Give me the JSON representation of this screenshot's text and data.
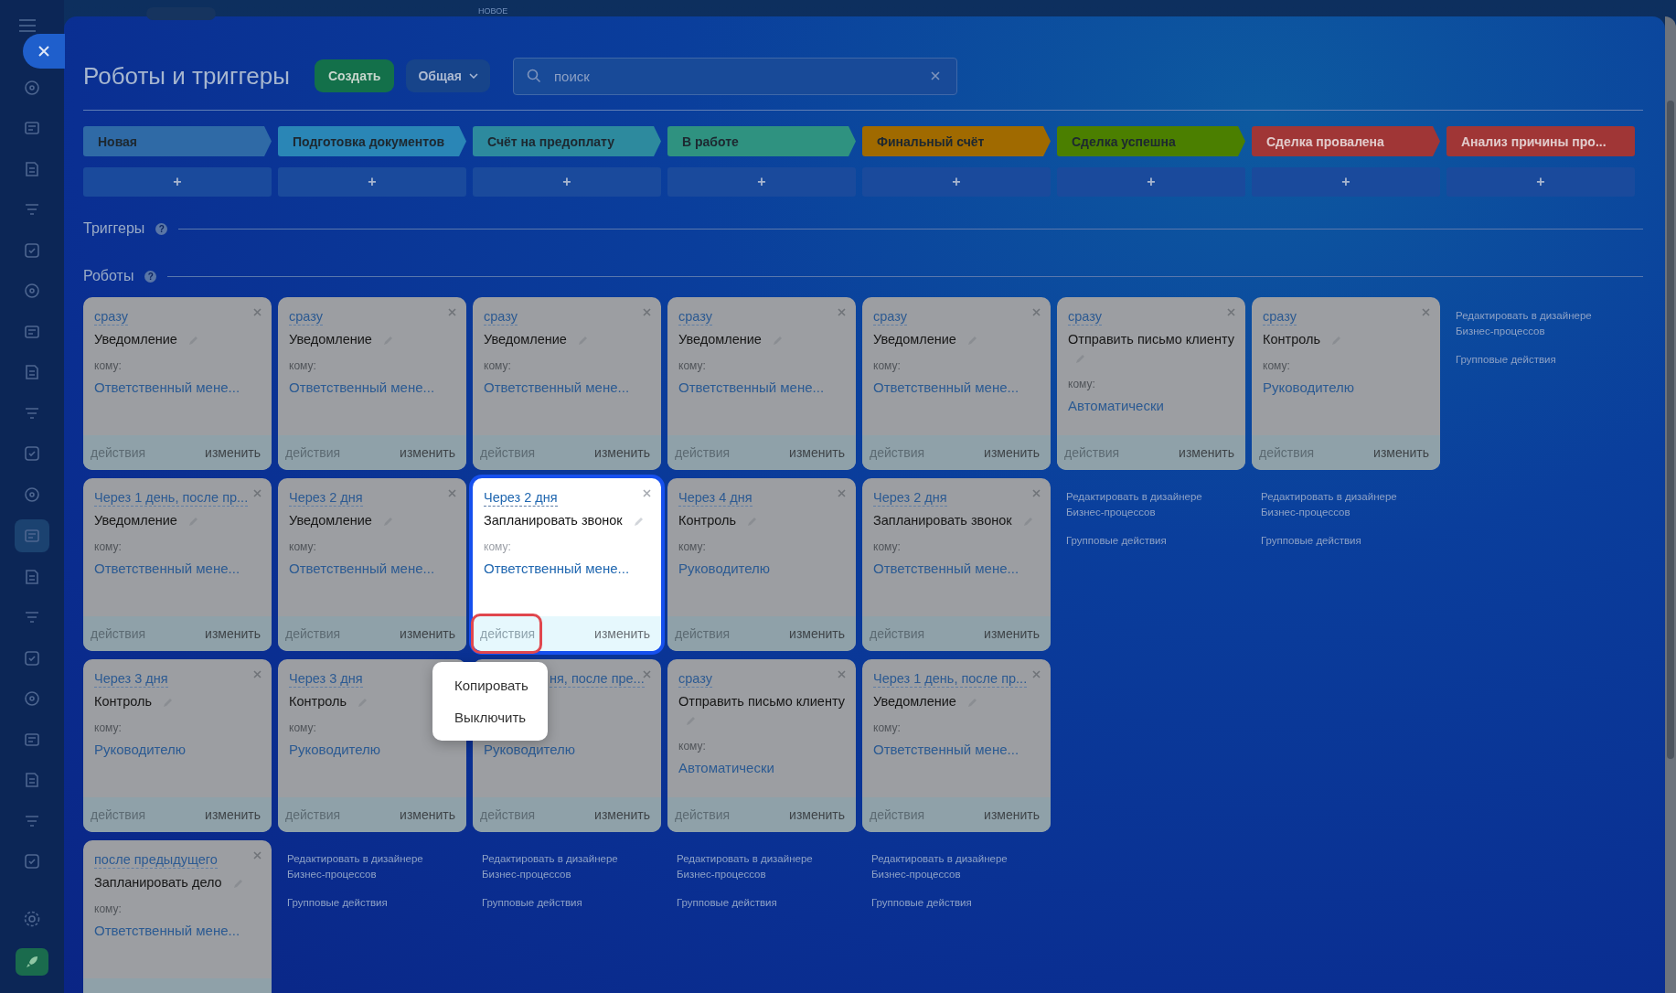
{
  "background_label": "НОВОЕ",
  "title": "Роботы и триггеры",
  "create_button": "Создать",
  "filter_dropdown": "Общая",
  "search": {
    "placeholder": "поиск"
  },
  "stages": [
    {
      "name": "Новая",
      "color": "#2f6aa6",
      "add": "+"
    },
    {
      "name": "Подготовка документов",
      "color": "#2a86b6",
      "add": "+"
    },
    {
      "name": "Счёт на предоплату",
      "color": "#2d8a9e",
      "add": "+"
    },
    {
      "name": "В работе",
      "color": "#2f9280",
      "add": "+"
    },
    {
      "name": "Финальный счёт",
      "color": "#a06a00",
      "add": "+"
    },
    {
      "name": "Сделка успешна",
      "color": "#4b7f00",
      "add": "+"
    },
    {
      "name": "Сделка провалена",
      "color": "#a03636",
      "add": "+"
    },
    {
      "name": "Анализ причины про...",
      "color": "#a03636",
      "add": "+"
    }
  ],
  "sections": [
    {
      "title": "Триггеры",
      "help": "?"
    },
    {
      "title": "Роботы",
      "help": "?"
    }
  ],
  "columns": [
    {
      "robots": [
        {
          "kind": "card",
          "trigger": "сразу",
          "name": "Уведомление",
          "to_label": "кому:",
          "recipient": "Ответственный мене...",
          "actions": "действия",
          "edit": "изменить",
          "selected": false
        },
        {
          "kind": "card",
          "trigger": "Через 1 день, после пр...",
          "name": "Уведомление",
          "to_label": "кому:",
          "recipient": "Ответственный мене...",
          "actions": "действия",
          "edit": "изменить",
          "selected": false
        },
        {
          "kind": "card",
          "trigger": "Через 3 дня",
          "name": "Контроль",
          "to_label": "кому:",
          "recipient": "Руководителю",
          "actions": "действия",
          "edit": "изменить",
          "selected": false
        },
        {
          "kind": "card",
          "trigger": "после предыдущего",
          "name": "Запланировать дело",
          "to_label": "кому:",
          "recipient": "Ответственный мене...",
          "selected": false
        }
      ]
    },
    {
      "robots": [
        {
          "kind": "card",
          "trigger": "сразу",
          "name": "Уведомление",
          "to_label": "кому:",
          "recipient": "Ответственный мене...",
          "actions": "действия",
          "edit": "изменить",
          "selected": false
        },
        {
          "kind": "card",
          "trigger": "Через 2 дня",
          "name": "Уведомление",
          "to_label": "кому:",
          "recipient": "Ответственный мене...",
          "actions": "действия",
          "edit": "изменить",
          "selected": false
        },
        {
          "kind": "corner_covered",
          "trigger": "Через 3 дня",
          "name": "Контроль",
          "to_label": "кому:",
          "recipient": "Руководителю",
          "actions": "действия",
          "edit": "изменить",
          "selected": false
        }
      ],
      "links": [
        "Редактировать в дизайнере Бизнес-процессов",
        "Групповые действия"
      ]
    },
    {
      "robots": [
        {
          "kind": "card",
          "trigger": "сразу",
          "name": "Уведомление",
          "to_label": "кому:",
          "recipient": "Ответственный мене...",
          "actions": "действия",
          "edit": "изменить",
          "selected": false
        },
        {
          "kind": "card",
          "trigger": "Через 2 дня",
          "name": "Запланировать звонок",
          "to_label": "кому:",
          "recipient": "Ответственный мене...",
          "actions": "действия",
          "edit": "изменить",
          "selected": true
        },
        {
          "kind": "covered",
          "trigger": "ня, после пре...",
          "recipient": "Руководителю",
          "actions": "действия",
          "edit": "изменить",
          "selected": false
        }
      ],
      "links": [
        "Редактировать в дизайнере Бизнес-процессов",
        "Групповые действия"
      ]
    },
    {
      "robots": [
        {
          "kind": "card",
          "trigger": "сразу",
          "name": "Уведомление",
          "to_label": "кому:",
          "recipient": "Ответственный мене...",
          "actions": "действия",
          "edit": "изменить",
          "selected": false
        },
        {
          "kind": "card",
          "trigger": "Через 4 дня",
          "name": "Контроль",
          "to_label": "кому:",
          "recipient": "Руководителю",
          "actions": "действия",
          "edit": "изменить",
          "selected": false
        },
        {
          "kind": "card",
          "trigger": "сразу",
          "name": "Отправить письмо клиенту",
          "to_label": "кому:",
          "recipient": "Автоматически",
          "actions": "действия",
          "edit": "изменить",
          "selected": false
        }
      ],
      "links": [
        "Редактировать в дизайнере Бизнес-процессов",
        "Групповые действия"
      ]
    },
    {
      "robots": [
        {
          "kind": "card",
          "trigger": "сразу",
          "name": "Уведомление",
          "to_label": "кому:",
          "recipient": "Ответственный мене...",
          "actions": "действия",
          "edit": "изменить",
          "selected": false
        },
        {
          "kind": "card",
          "trigger": "Через 2 дня",
          "name": "Запланировать звонок",
          "to_label": "кому:",
          "recipient": "Ответственный мене...",
          "actions": "действия",
          "edit": "изменить",
          "selected": false
        },
        {
          "kind": "card",
          "trigger": "Через 1 день, после пр...",
          "name": "Уведомление",
          "to_label": "кому:",
          "recipient": "Ответственный мене...",
          "actions": "действия",
          "edit": "изменить",
          "selected": false
        }
      ],
      "links": [
        "Редактировать в дизайнере Бизнес-процессов",
        "Групповые действия"
      ]
    },
    {
      "robots": [
        {
          "kind": "card",
          "trigger": "сразу",
          "name": "Отправить письмо клиенту",
          "to_label": "кому:",
          "recipient": "Автоматически",
          "actions": "действия",
          "edit": "изменить",
          "selected": false
        }
      ],
      "links": [
        "Редактировать в дизайнере Бизнес-процессов",
        "Групповые действия"
      ]
    },
    {
      "robots": [
        {
          "kind": "card",
          "trigger": "сразу",
          "name": "Контроль",
          "to_label": "кому:",
          "recipient": "Руководителю",
          "actions": "действия",
          "edit": "изменить",
          "selected": false
        }
      ],
      "links": [
        "Редактировать в дизайнере Бизнес-процессов",
        "Групповые действия"
      ]
    },
    {
      "links": [
        "Редактировать в дизайнере Бизнес-процессов",
        "Групповые действия"
      ]
    }
  ],
  "context_menu": {
    "items": [
      "Копировать",
      "Выключить"
    ],
    "highlight": true
  }
}
